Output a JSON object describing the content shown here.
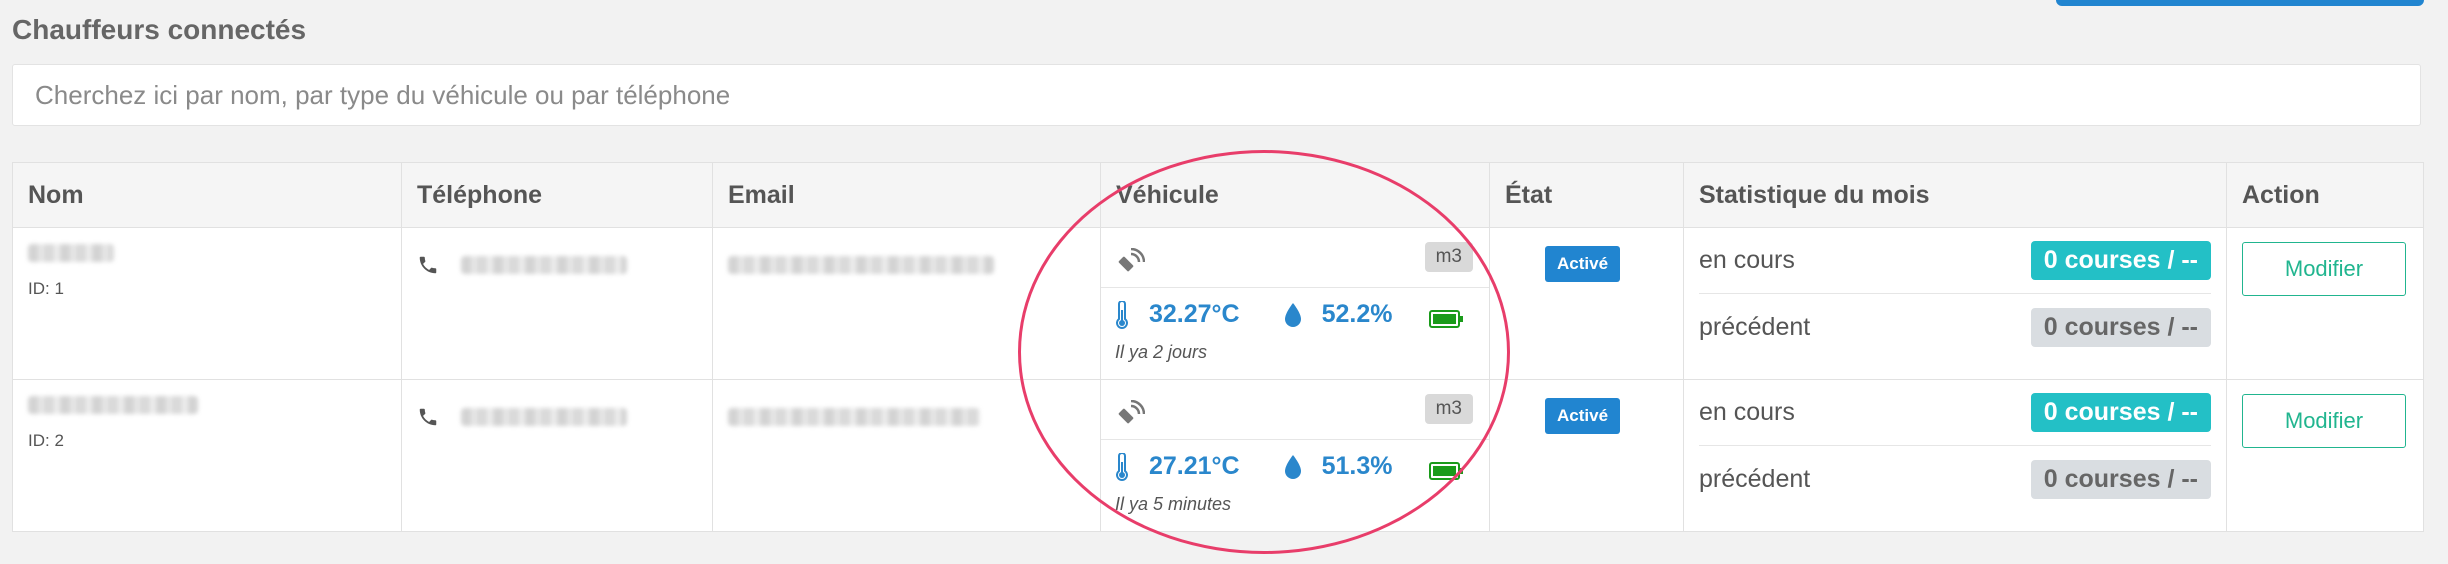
{
  "page": {
    "title": "Chauffeurs connectés"
  },
  "search": {
    "placeholder": "Cherchez ici par nom, par type du véhicule ou par téléphone"
  },
  "table": {
    "headers": [
      "Nom",
      "Téléphone",
      "Email",
      "Véhicule",
      "État",
      "Statistique du mois",
      "Action"
    ],
    "rows": [
      {
        "id_label": "ID: 1",
        "vehicle": {
          "type_badge": "m3",
          "temperature": "32.27°C",
          "humidity": "52.2%",
          "last_seen": "Il ya 2 jours"
        },
        "etat": "Activé",
        "stats": {
          "current_label": "en cours",
          "current_value": "0 courses / --",
          "previous_label": "précédent",
          "previous_value": "0 courses / --"
        },
        "action_label": "Modifier"
      },
      {
        "id_label": "ID: 2",
        "vehicle": {
          "type_badge": "m3",
          "temperature": "27.21°C",
          "humidity": "51.3%",
          "last_seen": "Il ya 5 minutes"
        },
        "etat": "Activé",
        "stats": {
          "current_label": "en cours",
          "current_value": "0 courses / --",
          "previous_label": "précédent",
          "previous_value": "0 courses / --"
        },
        "action_label": "Modifier"
      }
    ]
  },
  "colors": {
    "accent": "#2185d0",
    "metric": "#2a87cc",
    "cyan_pill": "#23c0c6",
    "modifier": "#21b58f",
    "annotation": "#e83d6a"
  },
  "icons": {
    "phone": "phone-icon",
    "signal": "satellite-signal-icon",
    "temperature": "thermometer-icon",
    "humidity": "water-drop-icon",
    "battery": "battery-full-icon"
  }
}
